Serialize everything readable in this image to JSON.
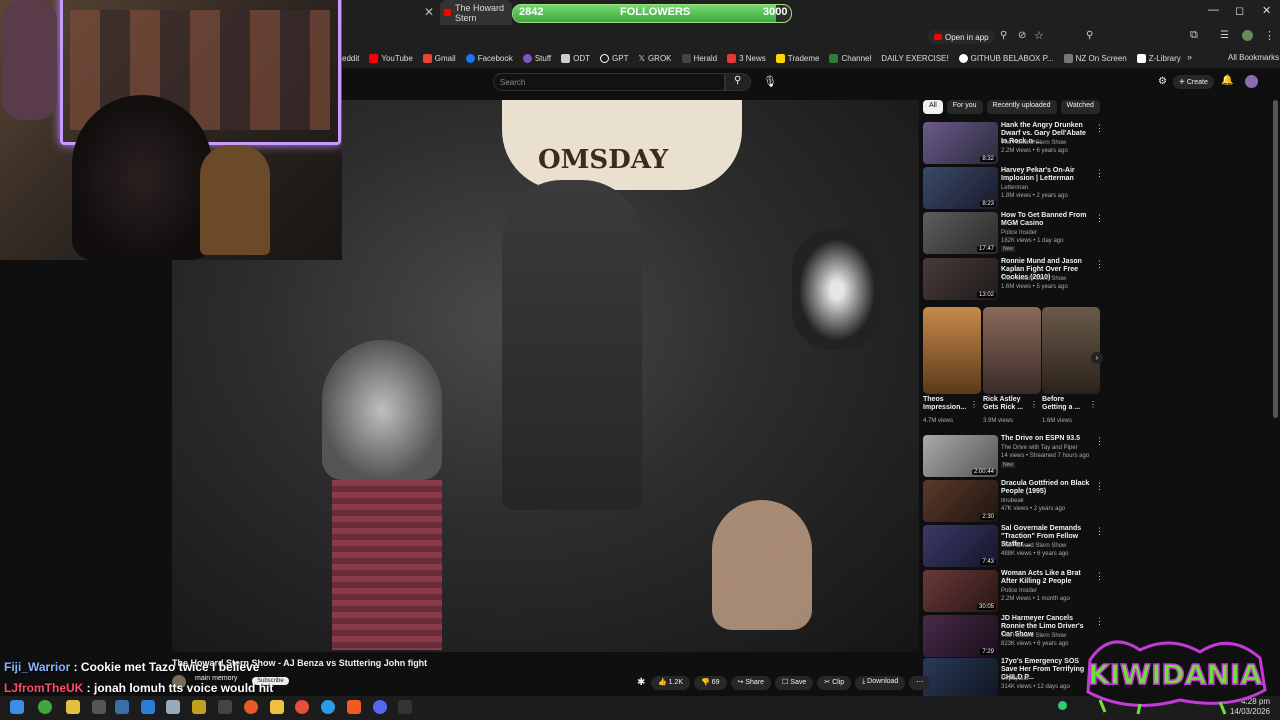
{
  "browser": {
    "active_tab": "The Howard Stern",
    "open_in_app": "Open in app",
    "window_controls": [
      "—",
      "◻",
      "✕"
    ]
  },
  "followers": {
    "current": "2842",
    "label": "FOLLOWERS",
    "goal": "3000",
    "progress": 0.947
  },
  "bookmarks": {
    "items": [
      {
        "label": "eddit",
        "color": "#ff4500"
      },
      {
        "label": "YouTube",
        "color": "#ff0000"
      },
      {
        "label": "Gmail",
        "color": "#ea4335"
      },
      {
        "label": "Facebook",
        "color": "#1877f2"
      },
      {
        "label": "Stuff",
        "color": "#7e57c2"
      },
      {
        "label": "ODT",
        "color": "#cccccc"
      },
      {
        "label": "GPT",
        "color": "#ffffff"
      },
      {
        "label": "GROK",
        "color": "#ffffff"
      },
      {
        "label": "Herald",
        "color": "#444444"
      },
      {
        "label": "3 News",
        "color": "#e53935"
      },
      {
        "label": "Trademe",
        "color": "#ffd600"
      },
      {
        "label": "Channel",
        "color": "#2e7d32"
      },
      {
        "label": "DAILY EXERCISE!",
        "color": "#333333"
      },
      {
        "label": "GITHUB BELABOX P...",
        "color": "#ffffff"
      },
      {
        "label": "NZ On Screen",
        "color": "#777777"
      },
      {
        "label": "Z-Library",
        "color": "#ffffff"
      }
    ],
    "all_bookmarks": "All Bookmarks"
  },
  "youtube": {
    "search_placeholder": "Search",
    "create_label": "Create",
    "video_title": "The Howard Stern Show - AJ Benza vs Stuttering John fight",
    "banner_text": "OMSDAY",
    "channel_name": "main memory",
    "subscribe": "Subscribe",
    "likes": "1.2K",
    "dislikes": "69",
    "share": "Share",
    "save": "Save",
    "clip": "Clip",
    "download": "Download",
    "chips": [
      "All",
      "For you",
      "Recently uploaded",
      "Watched"
    ],
    "recommendations": [
      {
        "title": "Hank the Angry Drunken Dwarf vs. Gary Dell'Abate In Rock-n-...",
        "channel": "The Howard Stern Show",
        "meta": "2.2M views • 6 years ago",
        "duration": "8:32",
        "badge": "",
        "color": "#6b5a8a"
      },
      {
        "title": "Harvey Pekar's On-Air Implosion | Letterman",
        "channel": "Letterman",
        "meta": "1.8M views • 2 years ago",
        "duration": "8:23",
        "badge": "",
        "color": "#3a4a6a"
      },
      {
        "title": "How To Get Banned From MGM Casino",
        "channel": "Police Insider",
        "meta": "182K views • 1 day ago",
        "duration": "17:47",
        "badge": "New",
        "color": "#5d5d5d"
      },
      {
        "title": "Ronnie Mund and Jason Kaplan Fight Over Free Cookies (2010)",
        "channel": "The Howard Stern Show",
        "meta": "1.6M views • 5 years ago",
        "duration": "13:02",
        "badge": "",
        "color": "#4a3b3b"
      },
      {
        "title": "The Drive on ESPN 93.5",
        "channel": "The Drive with Tay and Piper",
        "meta": "14 views • Streamed 7 hours ago",
        "duration": "2:00:44",
        "badge": "New",
        "color": "#777777"
      },
      {
        "title": "Dracula Gottfried on Black People (1995)",
        "channel": "tinubeak",
        "meta": "47K views • 2 years ago",
        "duration": "2:30",
        "badge": "",
        "color": "#5a3a2a"
      },
      {
        "title": "Sal Governale Demands \"Traction\" From Fellow Staffer ...",
        "channel": "The Howard Stern Show",
        "meta": "488K views • 6 years ago",
        "duration": "7:43",
        "badge": "",
        "color": "#3a3a6a"
      },
      {
        "title": "Woman Acts Like a Brat After Killing 2 People",
        "channel": "Police Insider",
        "meta": "2.2M views • 1 month ago",
        "duration": "30:05",
        "badge": "",
        "color": "#6a3a3a"
      },
      {
        "title": "JD Harmeyer Cancels Ronnie the Limo Driver's Car Show",
        "channel": "The Howard Stern Show",
        "meta": "823K views • 6 years ago",
        "duration": "7:29",
        "badge": "",
        "color": "#4a2a4a"
      },
      {
        "title": "17yo's Emergency SOS Save Her From Terrifying CHILD P...",
        "channel": "Unpopular",
        "meta": "314K views • 12 days ago",
        "duration": "",
        "badge": "",
        "color": "#2a3a5a"
      }
    ],
    "shorts": [
      {
        "title": "Theos Impression...",
        "views": "4.7M views",
        "color": "#c88a4a"
      },
      {
        "title": "Rick Astley Gets Rick ...",
        "views": "3.9M views",
        "color": "#8a6a5a"
      },
      {
        "title": "Before Getting a ...",
        "views": "1.6M views",
        "color": "#6a5a4a"
      }
    ]
  },
  "chat": [
    {
      "user": "Fiji_Warrior",
      "message": "Cookie met Tazo twice I believe",
      "color": "#8ab4ff"
    },
    {
      "user": "LJfromTheUK",
      "message": "jonah lomuh tts voice would hit",
      "color": "#ff4d6d"
    }
  ],
  "overlay_logo": "KIWIDANIA",
  "clock": {
    "time": "4:28 pm",
    "date": "14/03/2026"
  }
}
